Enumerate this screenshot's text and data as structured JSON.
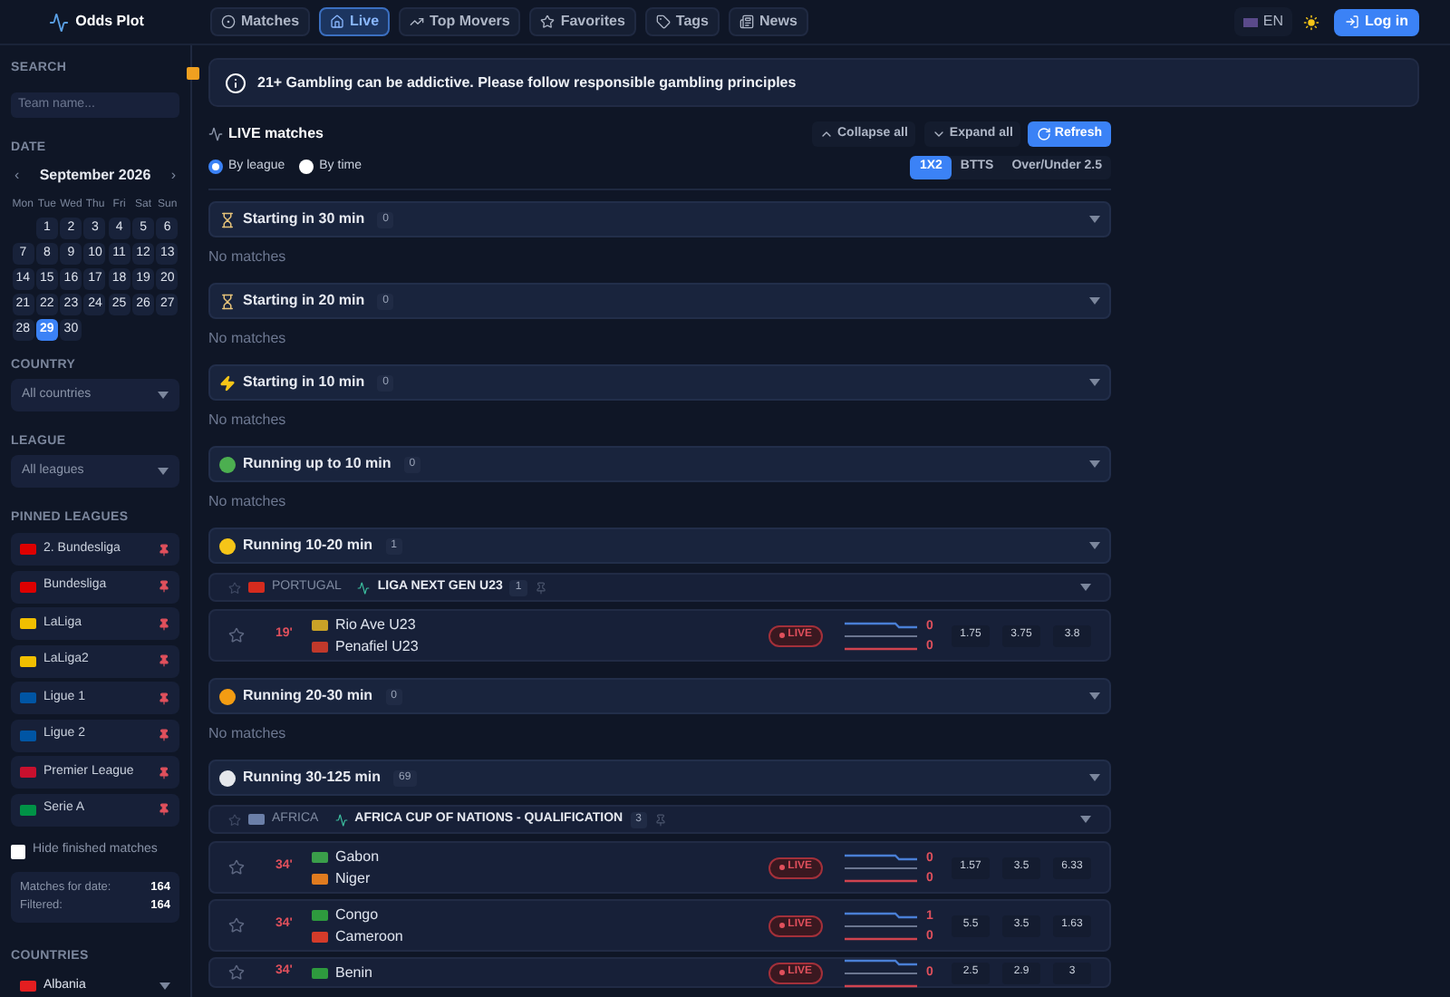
{
  "header": {
    "brand": "Odds Plot",
    "nav": [
      {
        "label": "Matches",
        "selected": false
      },
      {
        "label": "Live",
        "selected": true
      },
      {
        "label": "Top Movers",
        "selected": false
      },
      {
        "label": "Favorites",
        "selected": false
      },
      {
        "label": "Tags",
        "selected": false
      },
      {
        "label": "News",
        "selected": false
      }
    ],
    "language": "EN",
    "login": "Log in"
  },
  "sidebar": {
    "search": {
      "label": "SEARCH",
      "placeholder": "Team name..."
    },
    "date": {
      "label": "DATE",
      "month": "September 2026",
      "prev": "‹",
      "next": "›",
      "weekdays": [
        "Mon",
        "Tue",
        "Wed",
        "Thu",
        "Fri",
        "Sat",
        "Sun"
      ],
      "weeks": [
        [
          {
            "day": "1",
            "selected": false
          },
          {
            "day": "2",
            "selected": false
          },
          {
            "day": "3",
            "selected": false
          },
          {
            "day": "4",
            "selected": false
          },
          {
            "day": "5",
            "selected": false
          },
          {
            "day": "6",
            "selected": false
          }
        ],
        [
          {
            "day": "7",
            "selected": false
          },
          {
            "day": "8",
            "selected": false
          },
          {
            "day": "9",
            "selected": false
          },
          {
            "day": "10",
            "selected": false
          },
          {
            "day": "11",
            "selected": false
          },
          {
            "day": "12",
            "selected": false
          },
          {
            "day": "13",
            "selected": false
          }
        ],
        [
          {
            "day": "14",
            "selected": false
          },
          {
            "day": "15",
            "selected": false
          },
          {
            "day": "16",
            "selected": false
          },
          {
            "day": "17",
            "selected": false
          },
          {
            "day": "18",
            "selected": false
          },
          {
            "day": "19",
            "selected": false
          },
          {
            "day": "20",
            "selected": false
          }
        ],
        [
          {
            "day": "21",
            "selected": false
          },
          {
            "day": "22",
            "selected": false
          },
          {
            "day": "23",
            "selected": false
          },
          {
            "day": "24",
            "selected": false
          },
          {
            "day": "25",
            "selected": false
          },
          {
            "day": "26",
            "selected": false
          },
          {
            "day": "27",
            "selected": false
          }
        ],
        [
          {
            "day": "28",
            "selected": false
          },
          {
            "day": "29",
            "selected": true
          },
          {
            "day": "30",
            "selected": false
          }
        ]
      ]
    },
    "country": {
      "label": "COUNTRY",
      "value": "All countries"
    },
    "league": {
      "label": "LEAGUE",
      "value": "All leagues"
    },
    "pinned": {
      "label": "PINNED LEAGUES",
      "items": [
        {
          "name": "2. Bundesliga",
          "color": "#dd0000"
        },
        {
          "name": "Bundesliga",
          "color": "#dd0000"
        },
        {
          "name": "LaLiga",
          "color": "#f1bf00"
        },
        {
          "name": "LaLiga2",
          "color": "#f1bf00"
        },
        {
          "name": "Ligue 1",
          "color": "#0055a4"
        },
        {
          "name": "Ligue 2",
          "color": "#0055a4"
        },
        {
          "name": "Premier League",
          "color": "#c8102e"
        },
        {
          "name": "Serie A",
          "color": "#009246"
        }
      ]
    },
    "hide_finished": {
      "label": "Hide finished matches",
      "checked": false
    },
    "stats": [
      {
        "label": "Matches for date:",
        "value": "164"
      },
      {
        "label": "Filtered:",
        "value": "164"
      }
    ],
    "countries": {
      "label": "COUNTRIES",
      "items": [
        {
          "name": "Albania",
          "color": "#e41e20"
        }
      ]
    }
  },
  "banner": "21+ Gambling can be addictive. Please follow responsible gambling principles",
  "live": {
    "title": "LIVE matches",
    "collapse": "Collapse all",
    "expand": "Expand all",
    "refresh": "Refresh",
    "grouping": [
      {
        "label": "By league",
        "selected": true
      },
      {
        "label": "By time",
        "selected": false
      }
    ],
    "markets": [
      {
        "label": "1X2",
        "selected": true
      },
      {
        "label": "BTTS",
        "selected": false
      },
      {
        "label": "Over/Under 2.5",
        "selected": false
      }
    ],
    "sections": [
      {
        "kind": "hourglass",
        "title": "Starting in 30 min",
        "count": "0",
        "empty": "No matches"
      },
      {
        "kind": "hourglass",
        "title": "Starting in 20 min",
        "count": "0",
        "empty": "No matches"
      },
      {
        "kind": "bolt",
        "title": "Starting in 10 min",
        "count": "0",
        "empty": "No matches"
      },
      {
        "kind": "dot",
        "color": "#4caf50",
        "title": "Running up to 10 min",
        "count": "0",
        "empty": "No matches"
      },
      {
        "kind": "dot",
        "color": "#f5c518",
        "title": "Running 10-20 min",
        "count": "1",
        "leagues": [
          {
            "country": "PORTUGAL",
            "name": "LIGA NEXT GEN U23",
            "count": "1",
            "color": "#d52b1e",
            "matches": [
              {
                "minute": "19'",
                "live": "LIVE",
                "teams": [
                  {
                    "name": "Rio Ave U23",
                    "color": "#c9a227",
                    "score": "0"
                  },
                  {
                    "name": "Penafiel U23",
                    "color": "#c0392b",
                    "score": "0"
                  }
                ],
                "odds": [
                  "1.75",
                  "3.75",
                  "3.8"
                ]
              }
            ]
          }
        ]
      },
      {
        "kind": "dot",
        "color": "#f39c12",
        "title": "Running 20-30 min",
        "count": "0",
        "empty": "No matches"
      },
      {
        "kind": "dot",
        "color": "#e5e7eb",
        "title": "Running 30-125 min",
        "count": "69",
        "leagues": [
          {
            "country": "AFRICA",
            "name": "AFRICA CUP OF NATIONS - QUALIFICATION",
            "count": "3",
            "color": "#6b7fa8",
            "matches": [
              {
                "minute": "34'",
                "live": "LIVE",
                "teams": [
                  {
                    "name": "Gabon",
                    "color": "#3a9e4a",
                    "score": "0"
                  },
                  {
                    "name": "Niger",
                    "color": "#e07b1f",
                    "score": "0"
                  }
                ],
                "odds": [
                  "1.57",
                  "3.5",
                  "6.33"
                ]
              },
              {
                "minute": "34'",
                "live": "LIVE",
                "teams": [
                  {
                    "name": "Congo",
                    "color": "#2e9a3e",
                    "score": "1"
                  },
                  {
                    "name": "Cameroon",
                    "color": "#d43b2a",
                    "score": "0"
                  }
                ],
                "odds": [
                  "5.5",
                  "3.5",
                  "1.63"
                ]
              },
              {
                "minute": "34'",
                "live": "LIVE",
                "teams": [
                  {
                    "name": "Benin",
                    "color": "#2e9a3e",
                    "score": "0"
                  }
                ],
                "odds": [
                  "2.5",
                  "2.9",
                  "3"
                ]
              }
            ]
          }
        ]
      }
    ]
  }
}
